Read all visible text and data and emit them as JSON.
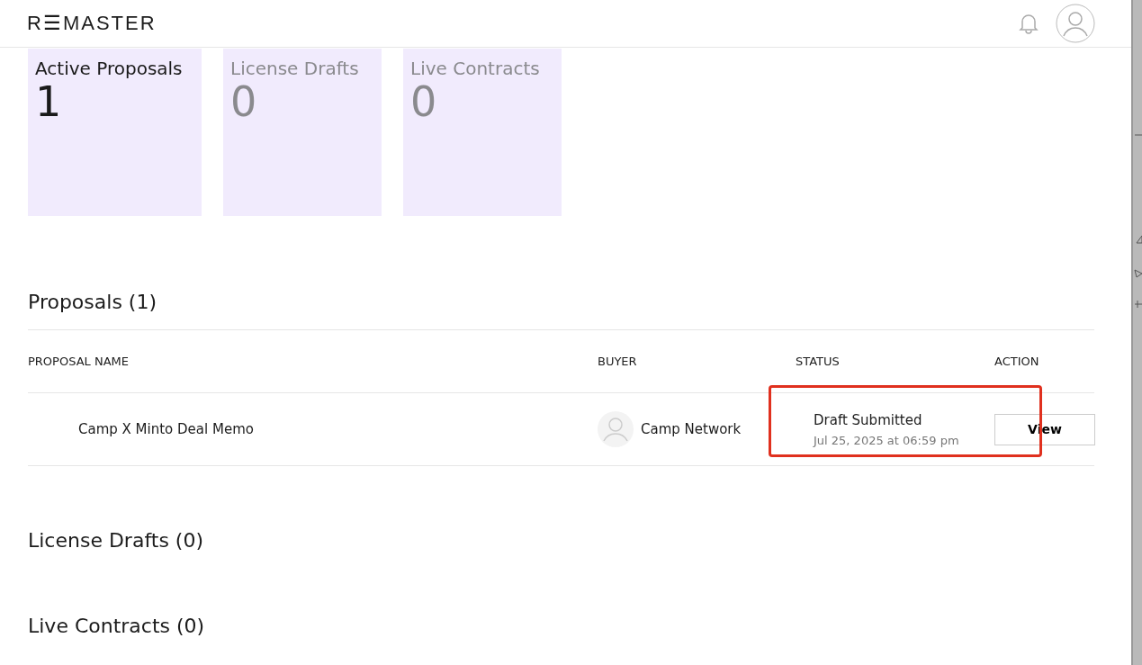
{
  "header": {
    "logo": "R☰MASTER"
  },
  "stats": [
    {
      "label": "Active Proposals",
      "value": "1",
      "selected": true
    },
    {
      "label": "License Drafts",
      "value": "0",
      "selected": false
    },
    {
      "label": "Live Contracts",
      "value": "0",
      "selected": false
    }
  ],
  "proposals": {
    "title": "Proposals (1)",
    "columns": [
      "PROPOSAL NAME",
      "BUYER",
      "STATUS",
      "ACTION"
    ],
    "rows": [
      {
        "name": "Camp X Minto Deal Memo",
        "buyer": "Camp Network",
        "status": "Draft Submitted",
        "date": "Jul 25, 2025 at 06:59 pm",
        "highlighted": true,
        "action": "View"
      }
    ]
  },
  "sections": [
    {
      "title": "License Drafts (0)"
    },
    {
      "title": "Live Contracts (0)"
    }
  ]
}
